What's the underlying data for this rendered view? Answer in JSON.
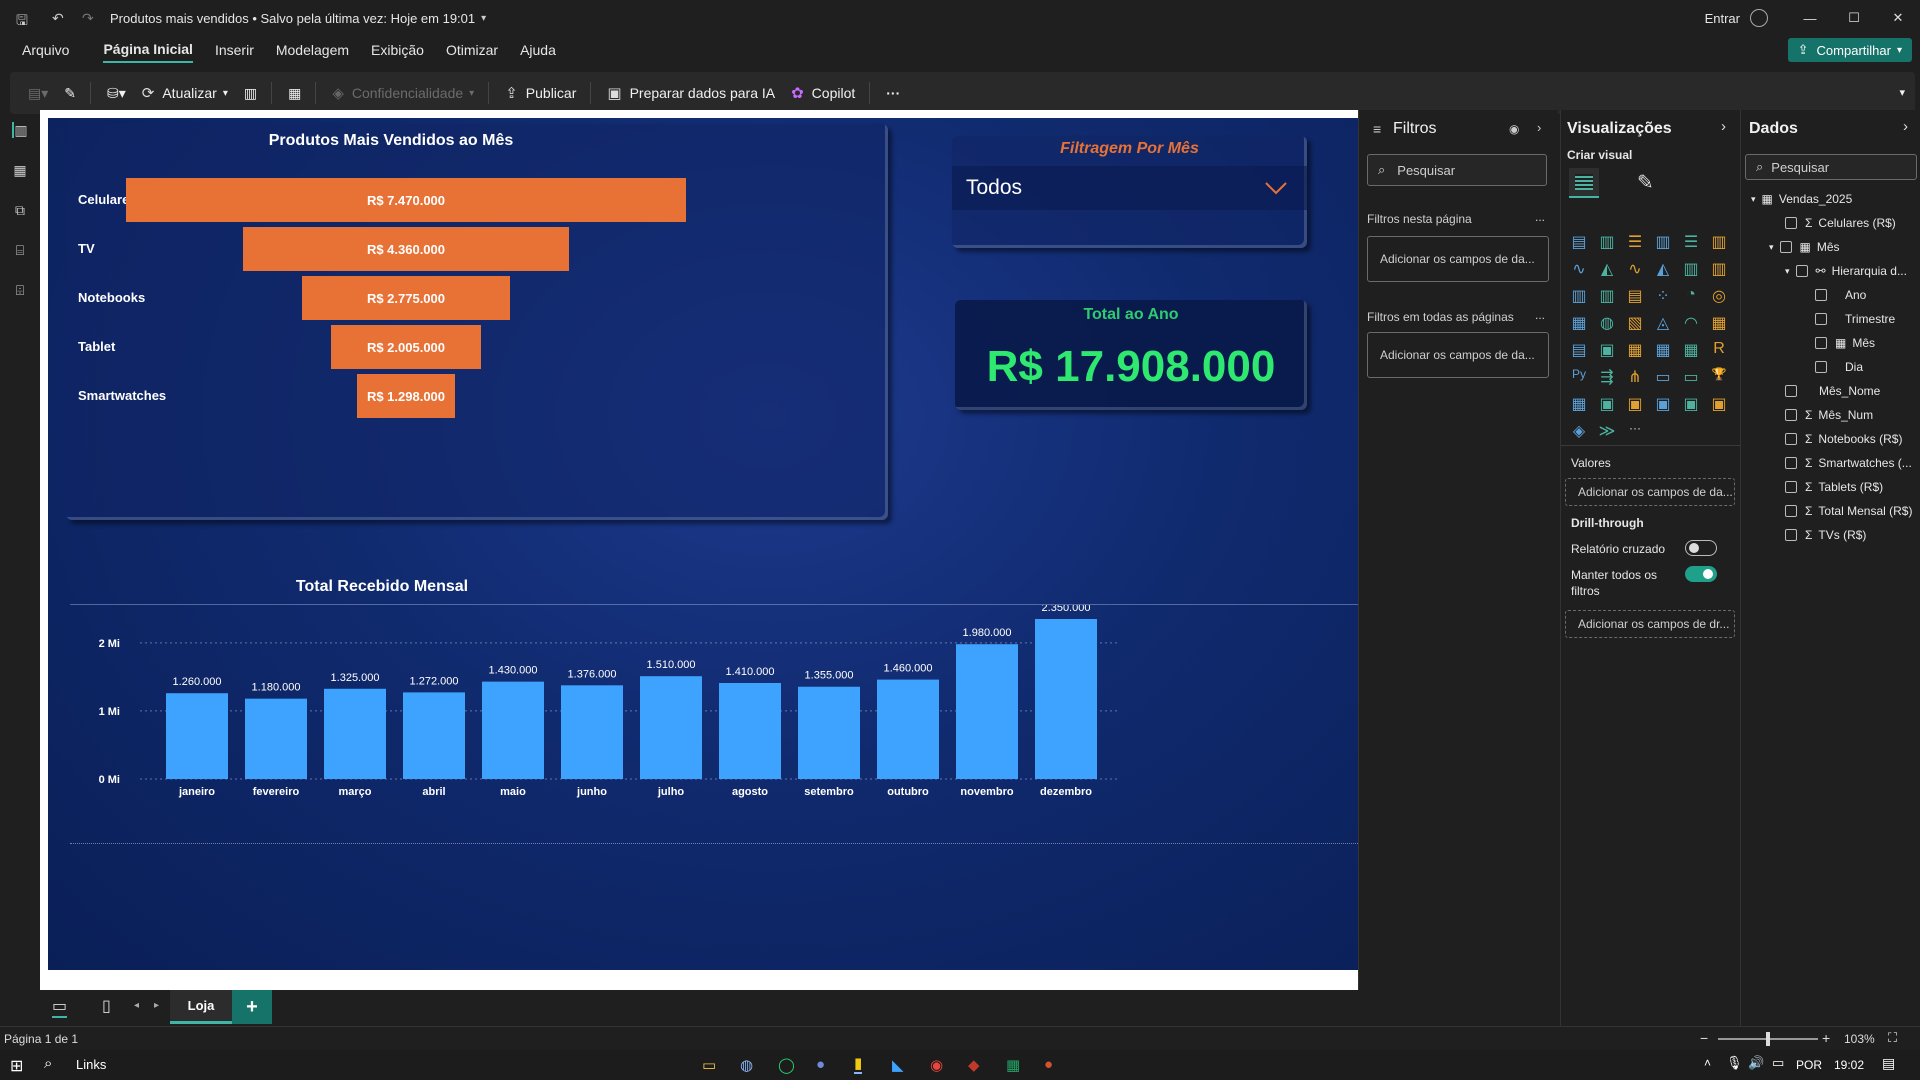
{
  "titlebar": {
    "title": "Produtos mais vendidos • Salvo pela última vez: Hoje em 19:01",
    "signin": "Entrar"
  },
  "menu": [
    "Arquivo",
    "Página Inicial",
    "Inserir",
    "Modelagem",
    "Exibição",
    "Otimizar",
    "Ajuda"
  ],
  "share_label": "Compartilhar",
  "ribbon": {
    "refresh": "Atualizar",
    "sensitivity": "Confidencialidade",
    "publish": "Publicar",
    "prepare": "Preparar dados para IA",
    "copilot": "Copilot",
    "more": "···"
  },
  "report": {
    "funnel": {
      "title": "Produtos Mais Vendidos ao Mês",
      "labels": [
        "Celulares",
        "TV",
        "Notebooks",
        "Tablet",
        "Smartwatches"
      ],
      "values_text": [
        "R$ 7.470.000",
        "R$ 4.360.000",
        "R$ 2.775.000",
        "R$ 2.005.000",
        "R$ 1.298.000"
      ]
    },
    "slicer": {
      "title": "Filtragem Por Mês",
      "value": "Todos"
    },
    "kpi": {
      "title": "Total ao Ano",
      "value": "R$ 17.908.000"
    },
    "column_chart_title": "Total Recebido Mensal"
  },
  "chart_data": [
    {
      "type": "bar",
      "title": "Produtos Mais Vendidos ao Mês",
      "orientation": "funnel",
      "categories": [
        "Celulares",
        "TV",
        "Notebooks",
        "Tablet",
        "Smartwatches"
      ],
      "values": [
        7470000,
        4360000,
        2775000,
        2005000,
        1298000
      ],
      "data_labels": [
        "R$ 7.470.000",
        "R$ 4.360.000",
        "R$ 2.775.000",
        "R$ 2.005.000",
        "R$ 1.298.000"
      ],
      "color": "#e87236"
    },
    {
      "type": "bar",
      "title": "Total Recebido Mensal",
      "categories": [
        "janeiro",
        "fevereiro",
        "março",
        "abril",
        "maio",
        "junho",
        "julho",
        "agosto",
        "setembro",
        "outubro",
        "novembro",
        "dezembro"
      ],
      "values": [
        1260000,
        1180000,
        1325000,
        1272000,
        1430000,
        1376000,
        1510000,
        1410000,
        1355000,
        1460000,
        1980000,
        2350000
      ],
      "data_labels": [
        "1.260.000",
        "1.180.000",
        "1.325.000",
        "1.272.000",
        "1.430.000",
        "1.376.000",
        "1.510.000",
        "1.410.000",
        "1.355.000",
        "1.460.000",
        "1.980.000",
        "2.350.000"
      ],
      "yticks": [
        "0 Mi",
        "1 Mi",
        "2 Mi"
      ],
      "ytick_values": [
        0,
        1000000,
        2000000
      ],
      "ylim": [
        0,
        2350000
      ],
      "grid": true,
      "color": "#3ea3ff"
    }
  ],
  "filters": {
    "title": "Filtros",
    "search_placeholder": "Pesquisar",
    "page_filters_label": "Filtros nesta página",
    "page_filters_drop": "Adicionar os campos de da...",
    "all_filters_label": "Filtros em todas as páginas",
    "all_filters_drop": "Adicionar os campos de da...",
    "more": "..."
  },
  "visualizations": {
    "title": "Visualizações",
    "build_label": "Criar visual",
    "values_label": "Valores",
    "values_drop": "Adicionar os campos de da...",
    "drill_label": "Drill-through",
    "cross_report": "Relatório cruzado",
    "keep_filters_line1": "Manter todos os",
    "keep_filters_line2": "filtros",
    "drill_drop": "Adicionar os campos de dr...",
    "more_icons": "···",
    "py_label": "Py",
    "r_label": "R"
  },
  "data_pane": {
    "title": "Dados",
    "search_placeholder": "Pesquisar",
    "table": "Vendas_2025",
    "fields": [
      "Celulares (R$)",
      "Mês",
      "Hierarquia d...",
      "Ano",
      "Trimestre",
      "Mês",
      "Dia",
      "Mês_Nome",
      "Mês_Num",
      "Notebooks (R$)",
      "Smartwatches (...",
      "Tablets (R$)",
      "Total Mensal (R$)",
      "TVs (R$)"
    ]
  },
  "tabs": {
    "page_tab": "Loja",
    "add": "+"
  },
  "status": {
    "page": "Página 1 de 1",
    "zoom": "103%"
  },
  "taskbar": {
    "links": "Links",
    "lang": "POR",
    "time": "19:02"
  }
}
